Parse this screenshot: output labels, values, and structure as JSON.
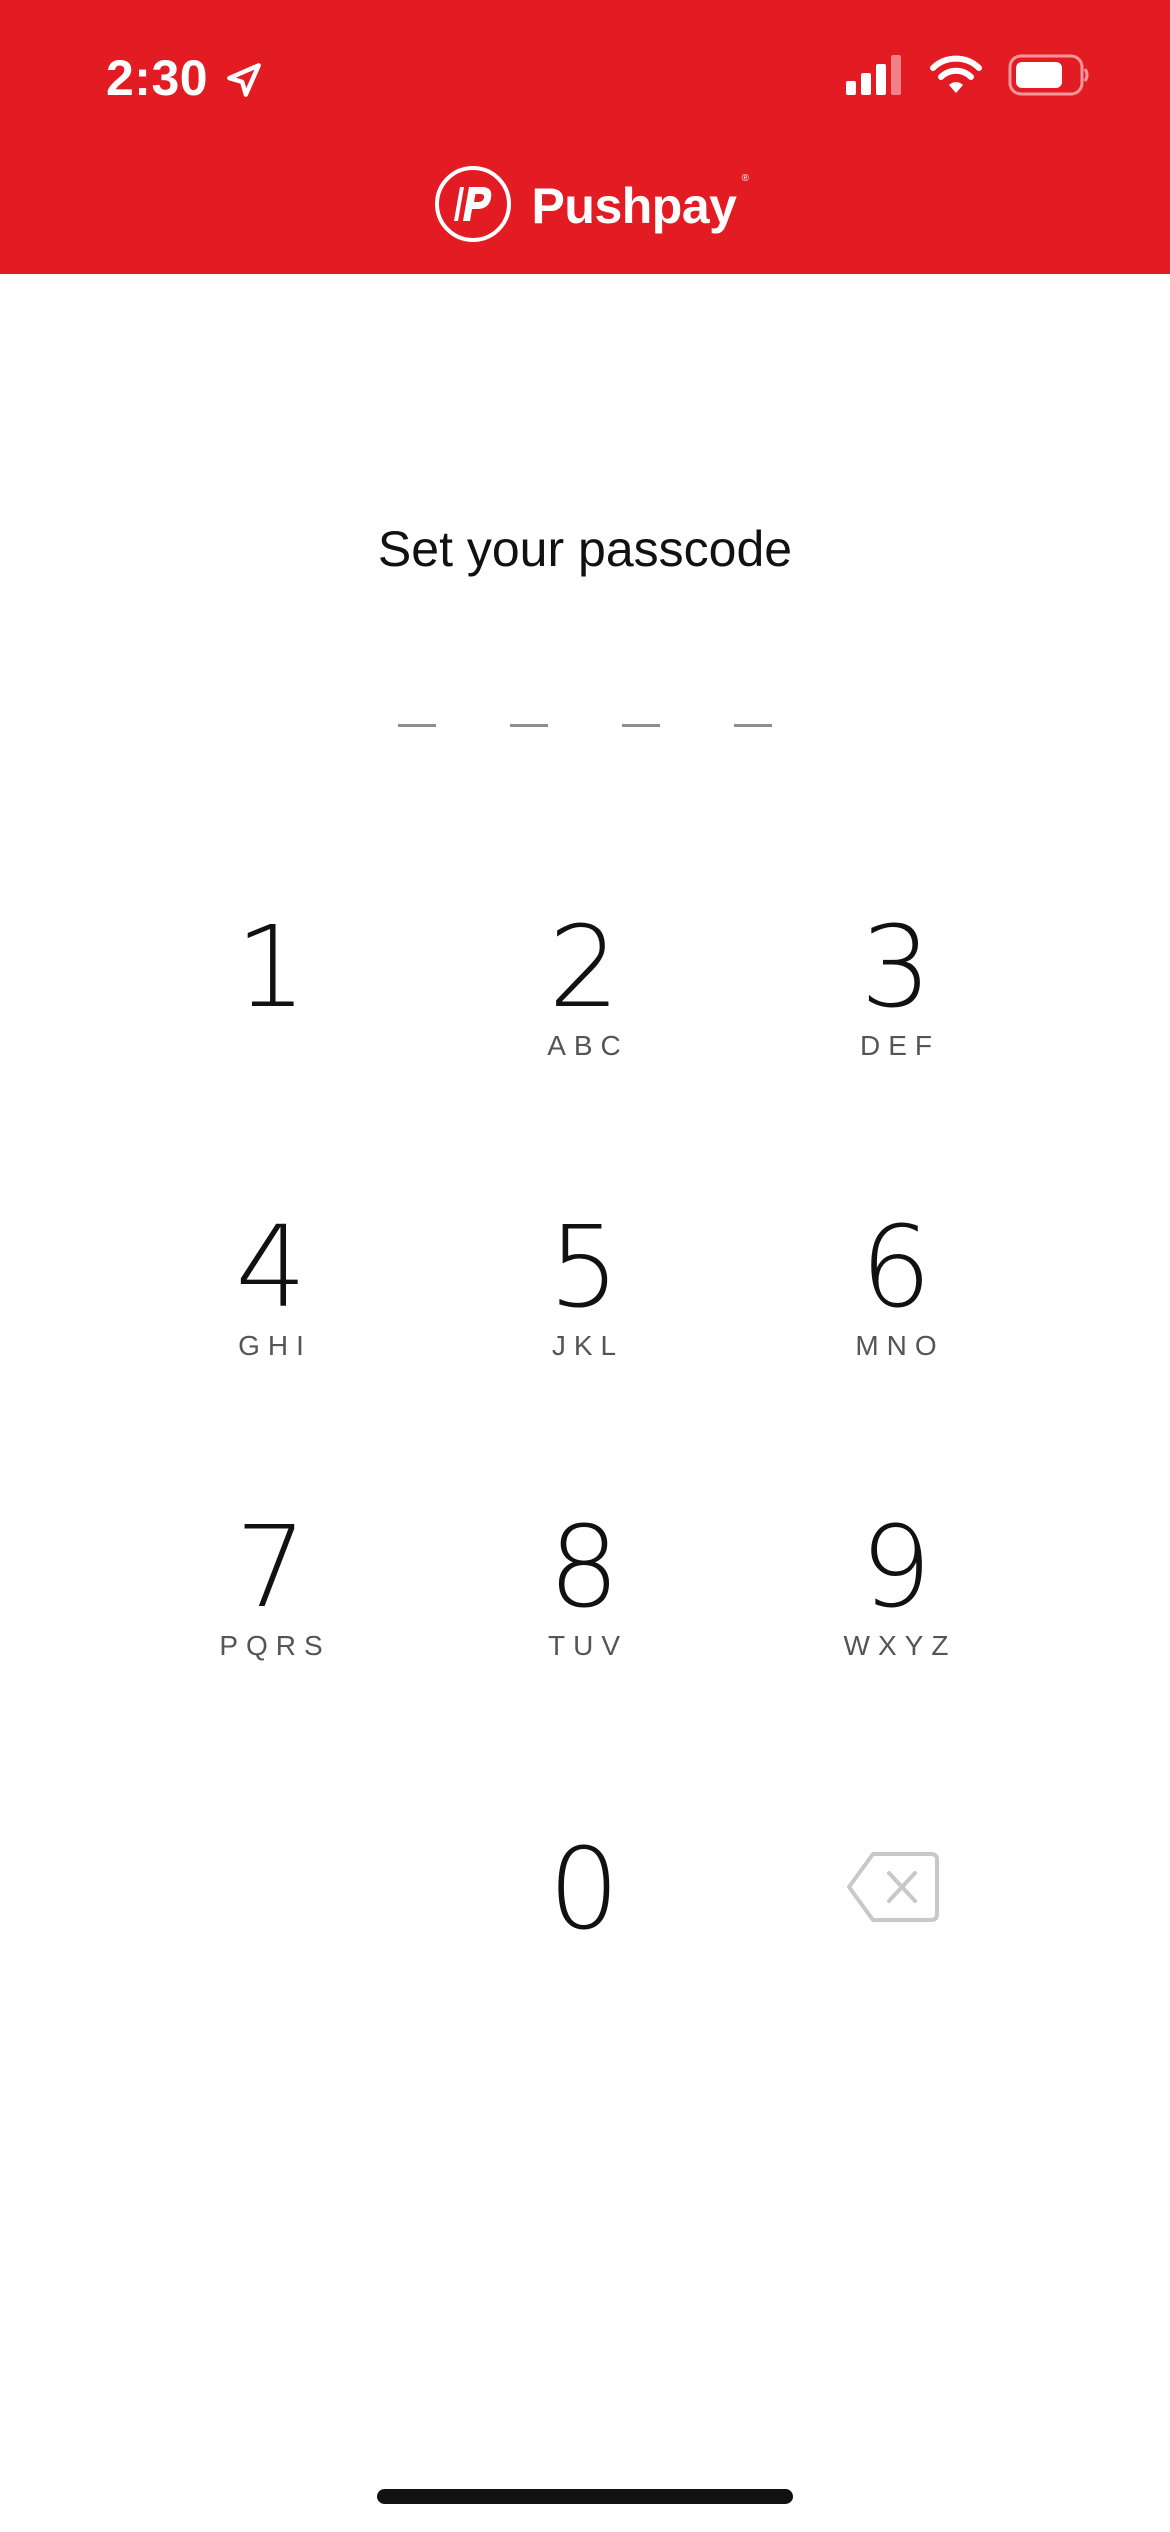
{
  "status_bar": {
    "time": "2:30"
  },
  "header": {
    "brand_name": "Pushpay",
    "brand_reg": "®",
    "logo_letter": "P",
    "background_color": "#e31b23"
  },
  "passcode": {
    "title": "Set your passcode",
    "digit_count": 4,
    "entered": 0
  },
  "keypad": {
    "keys": [
      {
        "digit": "1",
        "letters": ""
      },
      {
        "digit": "2",
        "letters": "ABC"
      },
      {
        "digit": "3",
        "letters": "DEF"
      },
      {
        "digit": "4",
        "letters": "GHI"
      },
      {
        "digit": "5",
        "letters": "JKL"
      },
      {
        "digit": "6",
        "letters": "MNO"
      },
      {
        "digit": "7",
        "letters": "PQRS"
      },
      {
        "digit": "8",
        "letters": "TUV"
      },
      {
        "digit": "9",
        "letters": "WXYZ"
      },
      {
        "digit": "0",
        "letters": ""
      }
    ],
    "backspace_icon": "delete-left-icon"
  }
}
